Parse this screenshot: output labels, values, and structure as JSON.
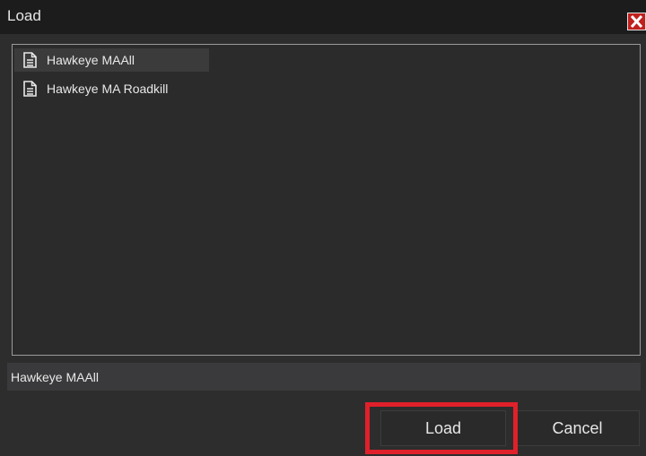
{
  "window": {
    "title": "Load",
    "close_icon": "close-icon"
  },
  "file_list": {
    "items": [
      {
        "label": "Hawkeye MAAll",
        "icon": "document-icon",
        "selected": true
      },
      {
        "label": "Hawkeye MA Roadkill",
        "icon": "document-icon",
        "selected": false
      }
    ]
  },
  "name_field": {
    "value": "Hawkeye MAAll"
  },
  "buttons": {
    "load_label": "Load",
    "cancel_label": "Cancel"
  },
  "colors": {
    "background": "#2d2d2d",
    "titlebar": "#1c1c1c",
    "close_button": "#c0201e",
    "highlight": "#e0202a"
  }
}
